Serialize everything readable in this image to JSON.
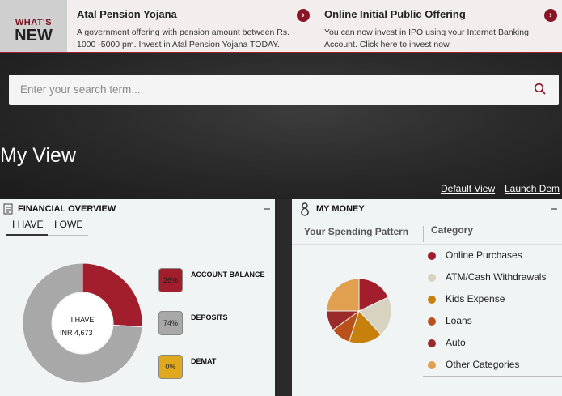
{
  "whats_new": {
    "line1": "WHAT'S",
    "line2": "NEW"
  },
  "news": [
    {
      "title": "Atal Pension Yojana",
      "desc_line1": "A government offering with pension amount between Rs.",
      "desc_line2": "1000 -5000 pm. Invest in Atal Pension Yojana TODAY."
    },
    {
      "title": "Online Initial Public Offering",
      "desc_line1": "You can now invest in IPO using your Internet Banking",
      "desc_line2": "Account. Click here to invest now."
    }
  ],
  "search": {
    "placeholder": "Enter your search term..."
  },
  "page_title": "My View",
  "links": {
    "default_view": "Default View",
    "launch_demo": "Launch Dem"
  },
  "financial_overview": {
    "title": "FINANCIAL OVERVIEW",
    "tabs": [
      "I HAVE",
      "I OWE"
    ],
    "center_label": "I HAVE",
    "center_value": "INR 4,673",
    "donut": [
      {
        "name": "ACCOUNT BALANCE",
        "percent": 26,
        "color": "#a31e2d"
      },
      {
        "name": "DEPOSITS",
        "percent": 74,
        "color": "#a8a8a8"
      },
      {
        "name": "DEMAT",
        "percent": 0,
        "color": "#e0a81c"
      }
    ],
    "chips": [
      {
        "label": "ACCOUNT BALANCE",
        "value": "26%",
        "color": "#a31e2d"
      },
      {
        "label": "DEPOSITS",
        "value": "74%",
        "color": "#a8a8a8"
      },
      {
        "label": "DEMAT",
        "value": "0%",
        "color": "#e0a81c"
      }
    ]
  },
  "my_money": {
    "title": "MY MONEY",
    "spending_label": "Your Spending Pattern",
    "category_label": "Category",
    "categories": [
      {
        "name": "Online Purchases",
        "color": "#a31e2d"
      },
      {
        "name": "ATM/Cash Withdrawals",
        "color": "#d8d2c0"
      },
      {
        "name": "Kids Expense",
        "color": "#c8800c"
      },
      {
        "name": "Loans",
        "color": "#b8521a"
      },
      {
        "name": "Auto",
        "color": "#9a2a2a"
      },
      {
        "name": "Other Categories",
        "color": "#e0a050"
      }
    ],
    "pie": [
      {
        "name": "Online Purchases",
        "percent": 18,
        "color": "#a31e2d"
      },
      {
        "name": "ATM/Cash Withdrawals",
        "percent": 20,
        "color": "#d8d2c0"
      },
      {
        "name": "Kids Expense",
        "percent": 17,
        "color": "#c8800c"
      },
      {
        "name": "Loans",
        "percent": 10,
        "color": "#b8521a"
      },
      {
        "name": "Auto",
        "percent": 10,
        "color": "#9a2a2a"
      },
      {
        "name": "Other Categories",
        "percent": 25,
        "color": "#e0a050"
      }
    ]
  }
}
